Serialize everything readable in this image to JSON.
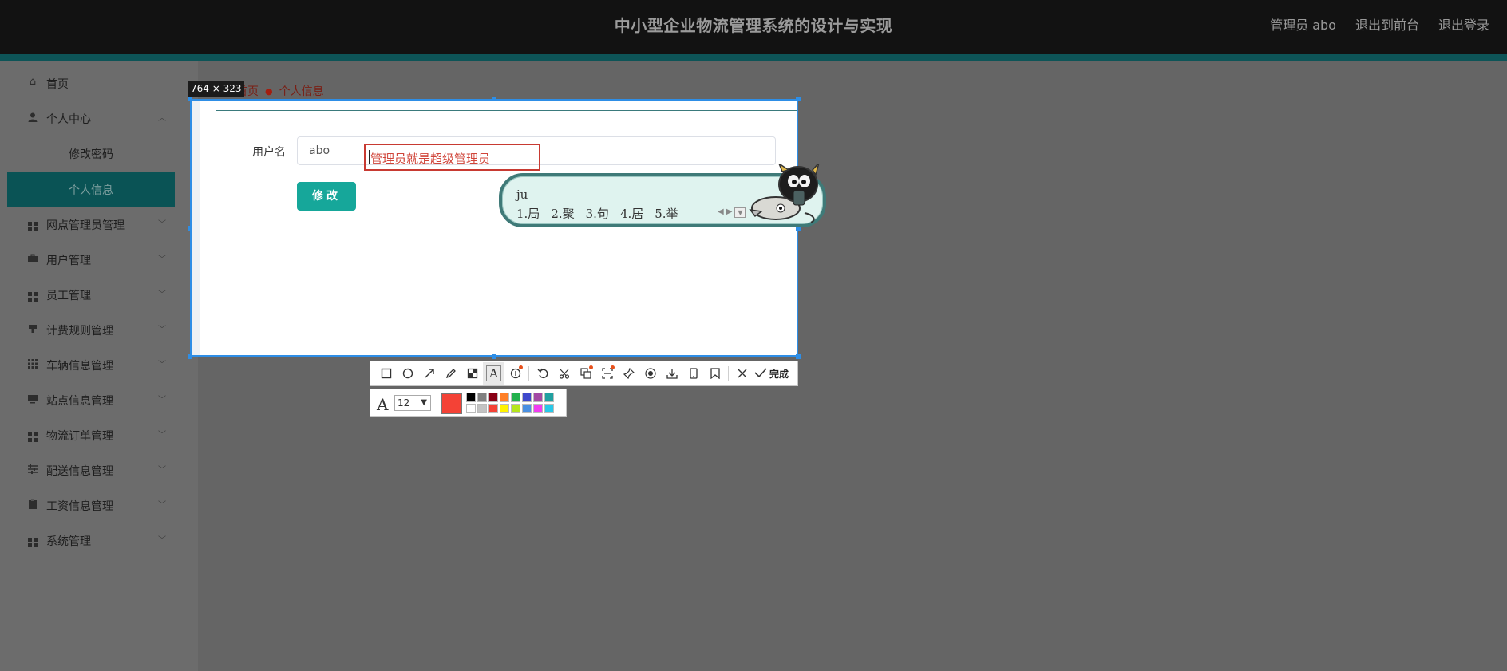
{
  "header": {
    "title": "中小型企业物流管理系统的设计与实现",
    "user": "管理员 abo",
    "back_to_front": "退出到前台",
    "logout": "退出登录"
  },
  "sidebar": {
    "items": [
      {
        "label": "首页",
        "icon": "home-icon"
      },
      {
        "label": "个人中心",
        "icon": "user-icon",
        "expanded": true
      },
      {
        "label": "修改密码",
        "sub": true
      },
      {
        "label": "个人信息",
        "sub": true,
        "active": true
      },
      {
        "label": "网点管理员管理",
        "icon": "grid-icon"
      },
      {
        "label": "用户管理",
        "icon": "briefcase-icon"
      },
      {
        "label": "员工管理",
        "icon": "grid-icon"
      },
      {
        "label": "计费规则管理",
        "icon": "stamp-icon"
      },
      {
        "label": "车辆信息管理",
        "icon": "apps-icon"
      },
      {
        "label": "站点信息管理",
        "icon": "monitor-icon"
      },
      {
        "label": "物流订单管理",
        "icon": "grid-icon"
      },
      {
        "label": "配送信息管理",
        "icon": "sliders-icon"
      },
      {
        "label": "工资信息管理",
        "icon": "clipboard-icon"
      },
      {
        "label": "系统管理",
        "icon": "grid-icon"
      }
    ]
  },
  "breadcrumb": {
    "home": "首页",
    "current": "个人信息"
  },
  "capture": {
    "size_label": "764 × 323"
  },
  "form": {
    "username_label": "用户名",
    "username_value": "abo",
    "annotation_text": "管理员就是超级管理员",
    "submit_label": "修改"
  },
  "ime": {
    "composition": "ju",
    "candidates": [
      "1.局",
      "2.聚",
      "3.句",
      "4.居",
      "5.举"
    ]
  },
  "toolbar": {
    "tools": [
      "rectangle-icon",
      "ellipse-icon",
      "arrow-icon",
      "pencil-icon",
      "mosaic-icon",
      "text-icon",
      "number-icon",
      "undo-icon",
      "cut-icon",
      "translate-icon",
      "ocr-icon",
      "pin-icon",
      "record-icon",
      "download-icon",
      "phone-icon",
      "bookmark-icon",
      "close-icon"
    ],
    "selected_tool": "text-icon",
    "done_label": "完成",
    "font_size": "12",
    "current_color": "#f44236",
    "palette": [
      "#000000",
      "#7f7f7f",
      "#880015",
      "#ff7f27",
      "#22b14c",
      "#3f48cc",
      "#a349a4",
      "#20a0a0",
      "#ffffff",
      "#c3c3c3",
      "#f44236",
      "#fff200",
      "#b5e61d",
      "#4a90e2",
      "#f03cf0",
      "#28c8e8"
    ]
  },
  "colors": {
    "accent": "#16a79a",
    "annotation": "#c83a32",
    "selection_border": "#2e8ee6"
  }
}
